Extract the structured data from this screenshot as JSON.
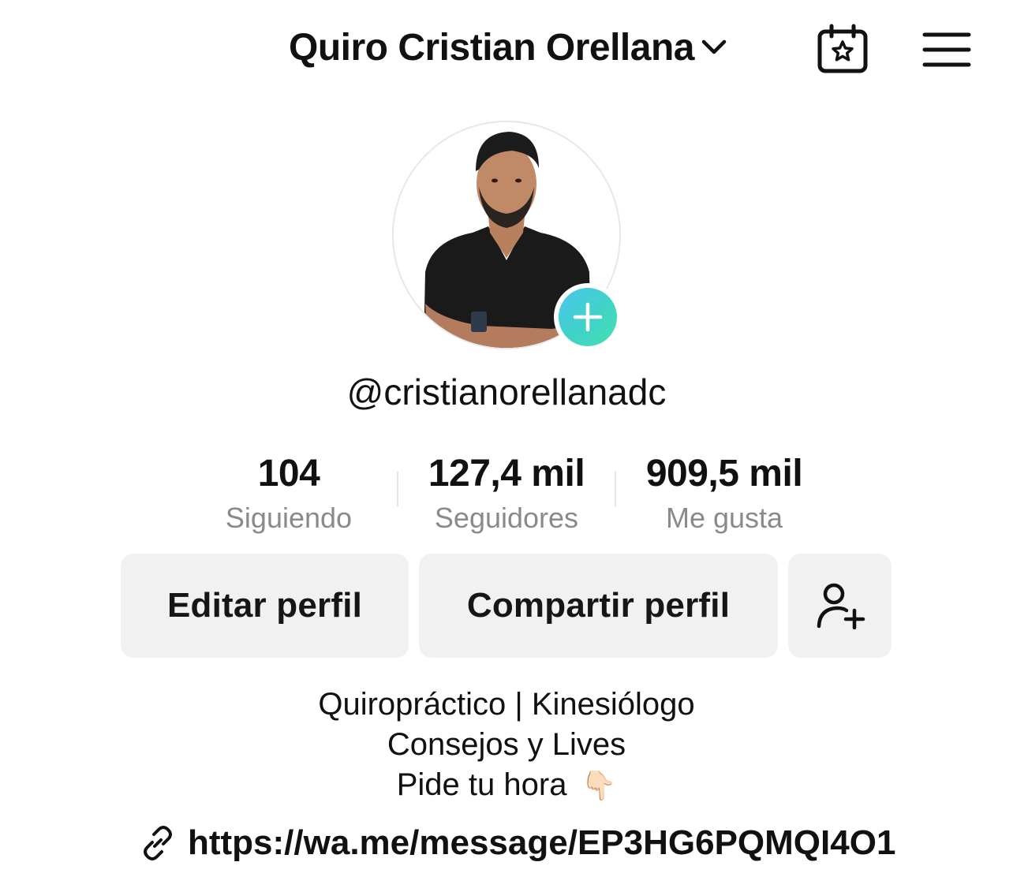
{
  "header": {
    "title": "Quiro Cristian Orellana",
    "dropdown_icon": "chevron-down-icon",
    "calendar_icon": "calendar-star-icon",
    "menu_icon": "hamburger-menu-icon"
  },
  "profile": {
    "username": "@cristianorellanadc",
    "add_badge_icon": "plus-icon",
    "badge_colors": [
      "#4bc5f0",
      "#45e0b0"
    ]
  },
  "stats": [
    {
      "value": "104",
      "label": "Siguiendo"
    },
    {
      "value": "127,4 mil",
      "label": "Seguidores"
    },
    {
      "value": "909,5 mil",
      "label": "Me gusta"
    }
  ],
  "buttons": {
    "edit": "Editar perfil",
    "share": "Compartir perfil",
    "add_friend_icon": "add-user-icon"
  },
  "bio": {
    "line1": "Quiropráctico | Kinesiólogo",
    "line2": "Consejos y Lives",
    "line3": "Pide tu hora",
    "line3_emoji": "👇🏻"
  },
  "link": {
    "icon": "link-icon",
    "url": "https://wa.me/message/EP3HG6PQMQI4O1"
  }
}
